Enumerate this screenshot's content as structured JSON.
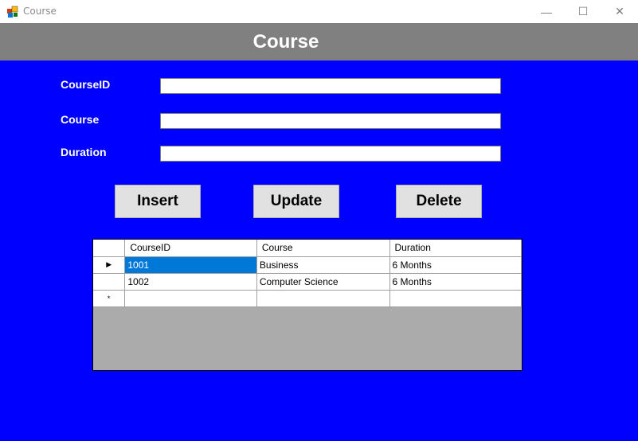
{
  "window": {
    "title": "Course",
    "minimize_glyph": "—",
    "maximize_glyph": "☐",
    "close_glyph": "✕",
    "icon": "windows-form-icon"
  },
  "header": {
    "title": "Course"
  },
  "form": {
    "courseid_label": "CourseID",
    "courseid_value": "",
    "course_label": "Course",
    "course_value": "",
    "duration_label": "Duration",
    "duration_value": ""
  },
  "buttons": {
    "insert": "Insert",
    "update": "Update",
    "delete": "Delete"
  },
  "grid": {
    "columns": [
      "CourseID",
      "Course",
      "Duration"
    ],
    "rows": [
      {
        "indicator": "▶",
        "cells": [
          "1001",
          "Business",
          "6 Months"
        ]
      },
      {
        "indicator": "",
        "cells": [
          "1002",
          "Computer Science",
          "6 Months"
        ]
      },
      {
        "indicator": "*",
        "cells": [
          "",
          "",
          ""
        ]
      }
    ]
  },
  "colors": {
    "form_background": "#0000ff",
    "header_background": "#808080",
    "selection": "#0078d7"
  }
}
